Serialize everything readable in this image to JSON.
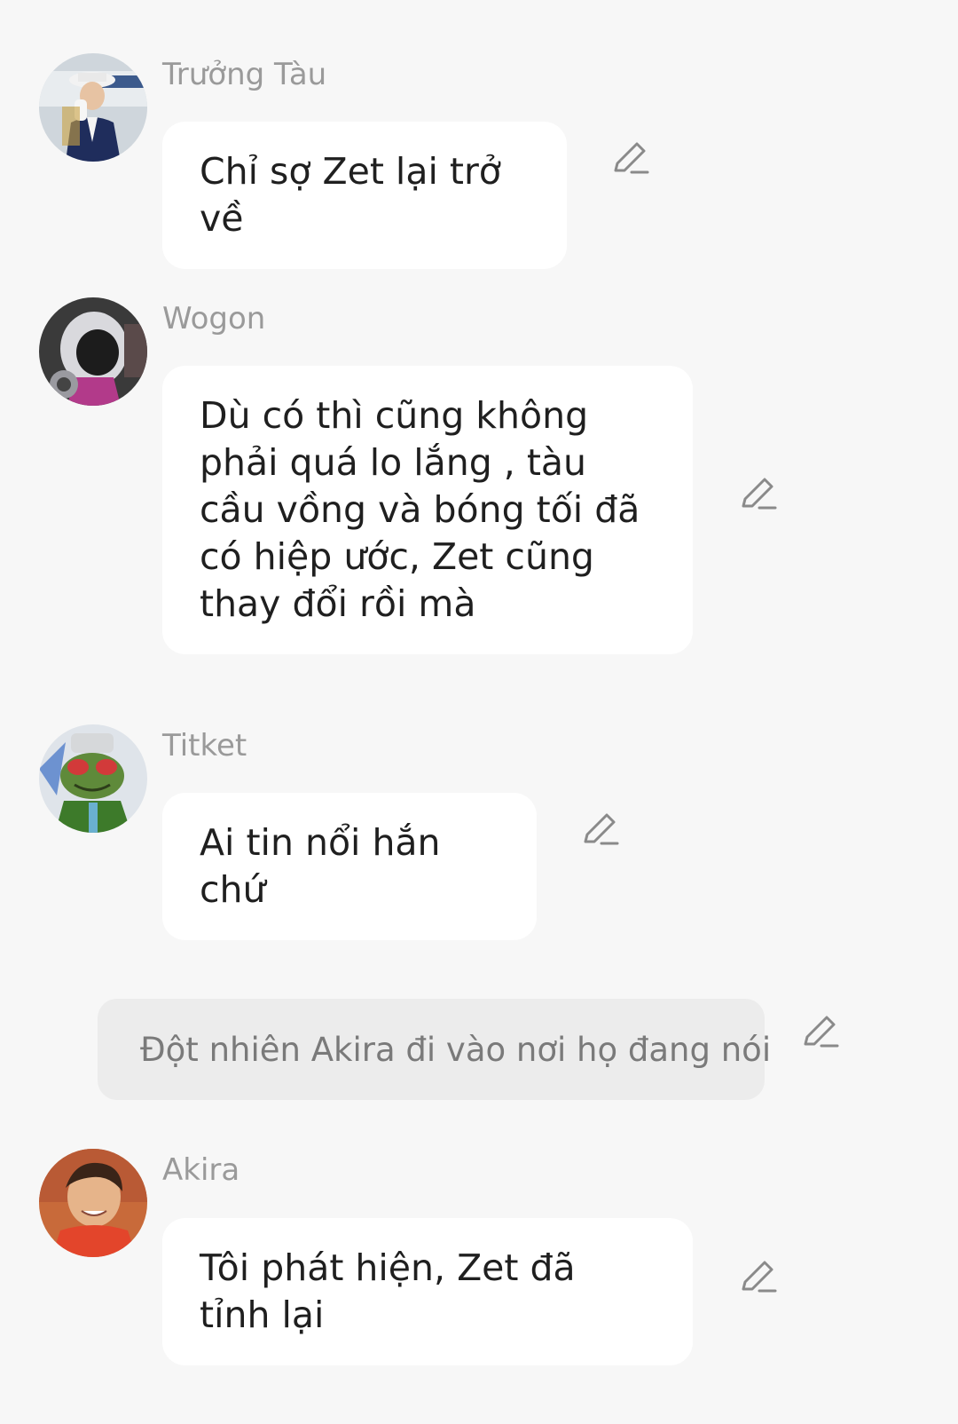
{
  "icons": {
    "edit": "pencil-edit-icon",
    "avatar": "avatar-photo"
  },
  "colors": {
    "background": "#f7f7f7",
    "bubble": "#ffffff",
    "narration_bubble": "#ececec",
    "name_text": "#9a9a9a",
    "message_text": "#1f1f1f",
    "narration_text": "#7a7a7a",
    "edit_icon": "#8a8a8a"
  },
  "messages": [
    {
      "name": "Trưởng Tàu",
      "text": "Chỉ sợ Zet lại trở về"
    },
    {
      "name": "Wogon",
      "text": "Dù có thì cũng không phải quá lo lắng , tàu cầu vồng và bóng tối đã có hiệp ước,  Zet cũng thay đổi rồi mà"
    },
    {
      "name": "Titket",
      "text": "Ai tin nổi hắn chứ"
    },
    {
      "narration": "Đột nhiên Akira đi vào nơi họ đang nói"
    },
    {
      "name": "Akira",
      "text": "Tôi phát hiện,  Zet đã tỉnh lại"
    }
  ]
}
